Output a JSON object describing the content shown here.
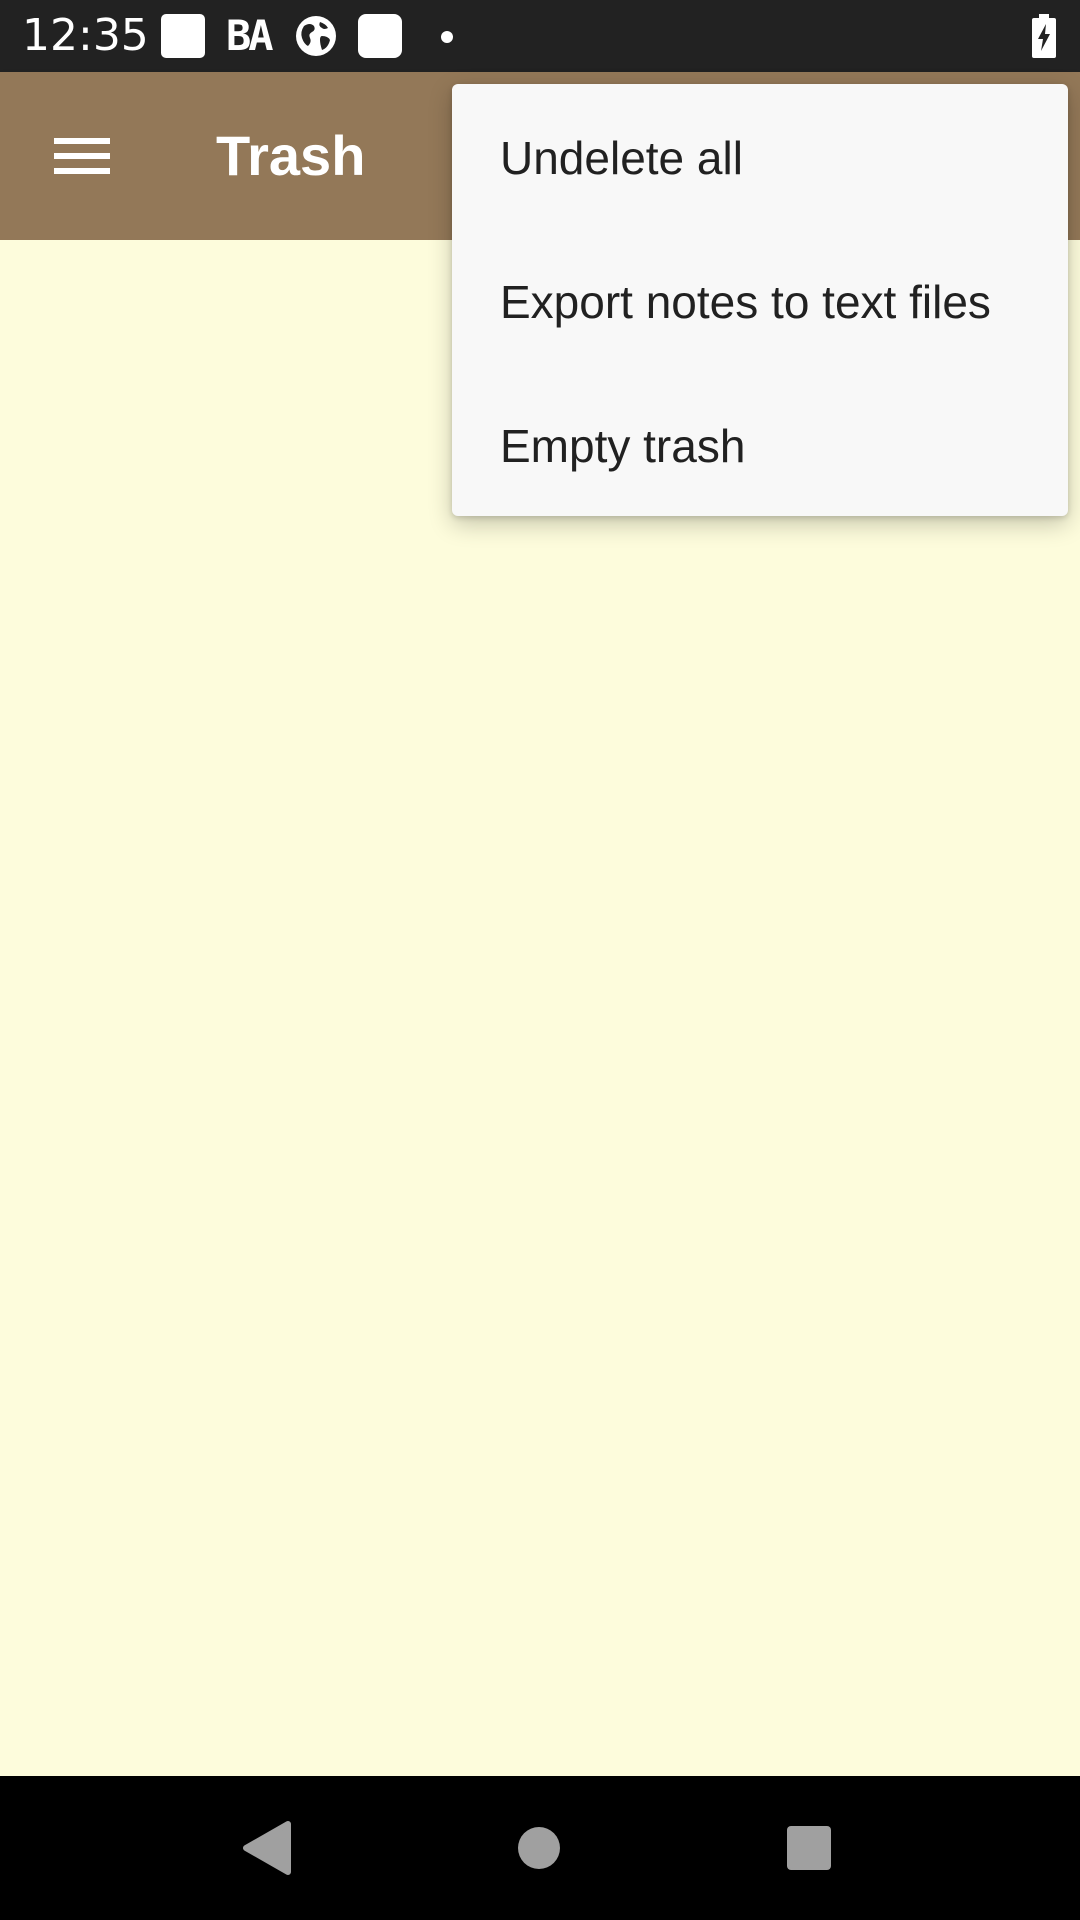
{
  "status_bar": {
    "time": "12:35",
    "carrier_label": "BA",
    "icons": [
      "notification-square-icon",
      "ba-icon",
      "globe-icon",
      "notification-square-icon",
      "dot-icon",
      "battery-charging-icon"
    ]
  },
  "app_bar": {
    "title": "Trash",
    "menu_icon": "hamburger-menu-icon",
    "color": "#937858"
  },
  "overflow_menu": {
    "items": [
      {
        "label": "Undelete all"
      },
      {
        "label": "Export notes to text files"
      },
      {
        "label": "Empty trash"
      }
    ]
  },
  "content": {
    "background": "#fdfcdc"
  },
  "nav_bar": {
    "buttons": [
      "back-icon",
      "home-icon",
      "recents-icon"
    ]
  }
}
